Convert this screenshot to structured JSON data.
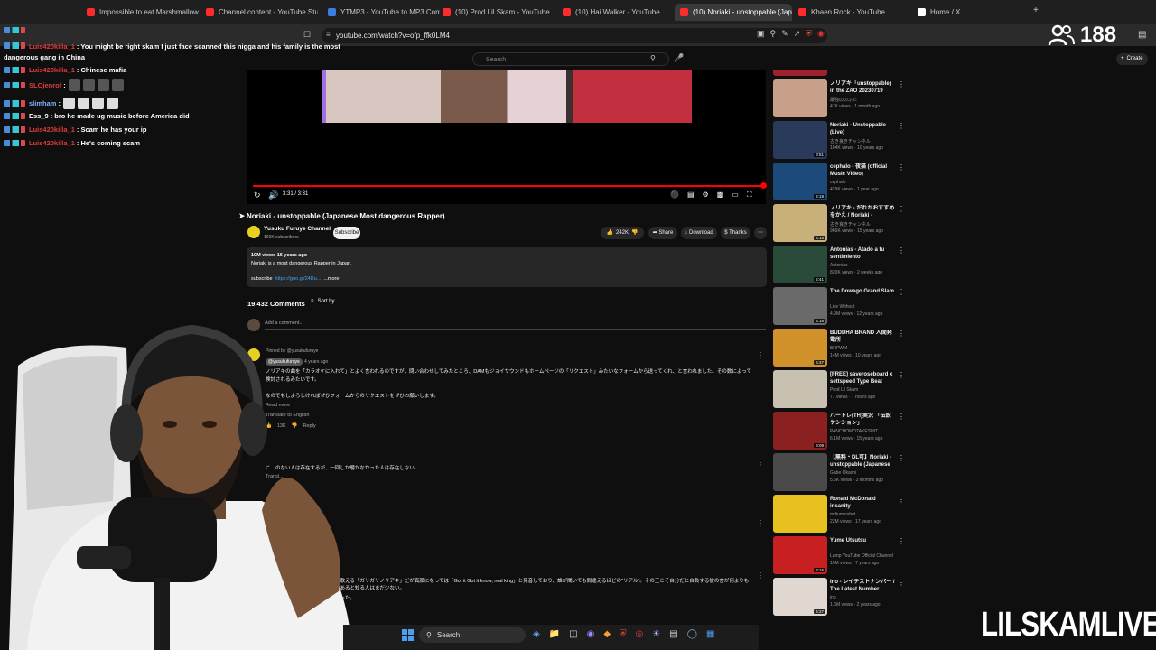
{
  "browser": {
    "tabs": [
      {
        "label": "Impossible to eat Marshmallow (15,0",
        "color": "#ff2a2a"
      },
      {
        "label": "Channel content - YouTube Studio",
        "color": "#ff2a2a"
      },
      {
        "label": "YTMP3 - YouTube to MP3 Converter",
        "color": "#3b7de0"
      },
      {
        "label": "(10) Prod Lil Skam - YouTube",
        "color": "#ff2a2a"
      },
      {
        "label": "(10) Hai Walker - YouTube",
        "color": "#ff2a2a"
      },
      {
        "label": "(10) Noriaki - unstoppable (Jap",
        "color": "#ff2a2a"
      },
      {
        "label": "Khaen Rock - YouTube",
        "color": "#ff2a2a"
      },
      {
        "label": "Home / X",
        "color": "#ffffff"
      }
    ],
    "url": "youtube.com/watch?v=ofp_ffk0LM4",
    "viewer_count": "188"
  },
  "yt_header": {
    "search_placeholder": "Search",
    "create_label": "Create"
  },
  "chat": [
    {
      "user": "",
      "msg": "",
      "user_color": "#e23b3b"
    },
    {
      "user": "Luis420killa_1",
      "msg": ": You might be right skam I just face scanned this nigga and his family is the most dangerous gang in China",
      "user_color": "#e23b3b"
    },
    {
      "user": "Luis420killa_1",
      "msg": ": Chinese mafia",
      "user_color": "#e23b3b"
    },
    {
      "user": "SLOjenrof",
      "msg": ":",
      "user_color": "#e23b3b"
    },
    {
      "user": "slimham",
      "msg": ":",
      "user_color": "#7fb2ff"
    },
    {
      "user": "Ess_9",
      "msg": ": bro he made ug music before America did",
      "user_color": "#ffffff"
    },
    {
      "user": "Luis420killa_1",
      "msg": ": Scam he has your ip",
      "user_color": "#e23b3b"
    },
    {
      "user": "Luis420killa_1",
      "msg": ": He's coming scam",
      "user_color": "#e23b3b"
    }
  ],
  "player": {
    "time": "3:31 / 3:31",
    "progress": 1.0
  },
  "video": {
    "title": "Noriaki - unstoppable (Japanese Most dangerous Rapper)",
    "channel": "Yusuku Furuye Channel",
    "subscribers": "169K subscribers",
    "subscribe_label": "Subscribe",
    "likes": "242K",
    "share_label": "Share",
    "download_label": "Download",
    "thanks_label": "Thanks",
    "views_date": "10M views  16 years ago",
    "description": "Noriaki is a most dangerous Rapper in Japan.",
    "subscribe_link_label": "subscribe",
    "subscribe_link": "https://goo.gl/24Du...",
    "more_label": "...more"
  },
  "comments": {
    "count_label": "19,432 Comments",
    "sort_label": "Sort by",
    "add_placeholder": "Add a comment...",
    "pinned_label": "Pinned by @yusukufuruye",
    "pinned_author": "@yusukufuruye",
    "pinned_time": "4 years ago",
    "pinned_text": "ノリアキの曲を「カラオケに入れて」とよく言われるのですが、問い合わせしてみたところ、DAMもジョイサウンドもホームページの「リクエスト」みたいなフォームから送ってくれ、と言われました。その数によって検討されるみたいです。",
    "pinned_text2": "なのでもしよろしければぜひフォームからのリクエストをぜひお願いします。",
    "read_more": "Read more",
    "translate": "Translate to English",
    "pinned_likes": "13K",
    "reply_label": "Reply",
    "comment2_text": "こ…のない人は存在するが、一回しか聴かなかった人は存在しない",
    "comment2_translate": "Transl...",
    "comment3_text": "ク…に歌える「ガリガリノリアキ」だが真顔になっては「Got it Got it know, real king」と発音しており、誰が聞いても間違えるほどの\"リアル\"。その王こそ自分だと自負する彼の言が何よりも説得力あると知る人はまだ少ない。",
    "comment3_tail": "…に取った。"
  },
  "sidebar": [
    {
      "title": "ノリアキ「unstoppable」 in the ZAO 20230719",
      "channel": "最強ののぶた",
      "meta": "41K views · 1 month ago",
      "dur": "",
      "color": "#c8a08a"
    },
    {
      "title": "Noriaki - Unstoppable (Live)",
      "channel": "古き良きチャンネル",
      "meta": "104K views · 10 years ago",
      "dur": "3:51",
      "color": "#2a3a5a"
    },
    {
      "title": "cephalo - 夜猫 (official Music Video)",
      "channel": "cephalo",
      "meta": "429K views · 1 year ago",
      "dur": "4:19",
      "color": "#1c4a7a"
    },
    {
      "title": "ノリアキ - だれかおすすめをかえ / Noriaki - Someone show...",
      "channel": "古き良きチャンネル",
      "meta": "966K views · 15 years ago",
      "dur": "3:15",
      "color": "#c8b07a"
    },
    {
      "title": "Antonias - Atado a tu sentimiento",
      "channel": "Antonias",
      "meta": "820K views · 2 weeks ago",
      "dur": "2:41",
      "color": "#2a4a3a"
    },
    {
      "title": "The Dowego Grand Slam",
      "channel": "Live Without",
      "meta": "4.9M views · 12 years ago",
      "dur": "4:18",
      "color": "#6a6a6a"
    },
    {
      "title": "BUDDHA BRAND 人間発電所",
      "channel": "BRPWM",
      "meta": "14M views · 10 years ago",
      "dur": "6:37",
      "color": "#d0902a"
    },
    {
      "title": "[FREE] saveroseboard x settspeed Type Beat (Prod. Lil ...",
      "channel": "Prod Lil Skam",
      "meta": "71 views · 7 hours ago",
      "dur": "",
      "color": "#c8c0b0"
    },
    {
      "title": "ハートレ(TH)実況 「伝説ケシション」",
      "channel": "PANCHOMOTAKESHIT",
      "meta": "6.1M views · 15 years ago",
      "dur": "3:09",
      "color": "#8a2020"
    },
    {
      "title": "【無料・DL可】Noriaki - unstoppable (Japanese Most ...",
      "channel": "Gabe Okashi",
      "meta": "5.5K views · 3 months ago",
      "dur": "",
      "color": "#4a4a4a"
    },
    {
      "title": "Ronald McDonald insanity",
      "channel": "mdiuminshot",
      "meta": "22M views · 17 years ago",
      "dur": "",
      "color": "#e8c020"
    },
    {
      "title": "Yume Utsutsu",
      "channel": "Lamp YouTube Official Channel",
      "meta": "10M views · 7 years ago",
      "dur": "3:16",
      "color": "#c82020"
    },
    {
      "title": "Ino - レイテストナンバー / The Latest Number",
      "channel": "ino",
      "meta": "1.6M views · 2 years ago",
      "dur": "4:27",
      "color": "#e0d8d0"
    }
  ],
  "taskbar": {
    "search_label": "Search"
  },
  "watermark": "LILSKAMLIVE"
}
